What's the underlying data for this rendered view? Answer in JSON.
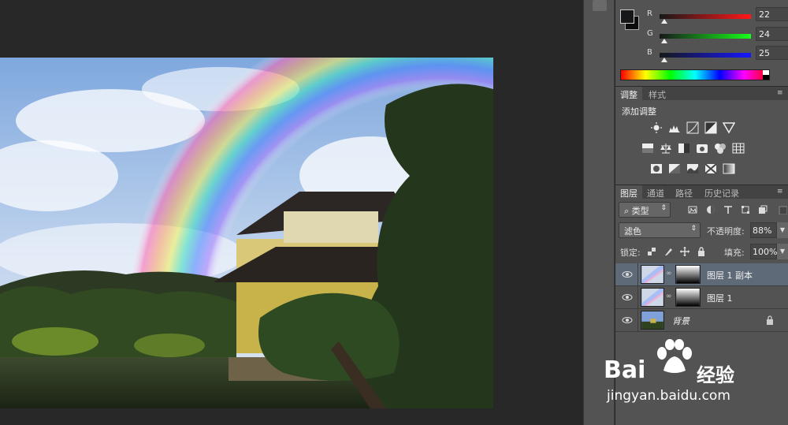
{
  "color_panel": {
    "r_label": "R",
    "r_value": "22",
    "g_label": "G",
    "g_value": "24",
    "b_label": "B",
    "b_value": "25",
    "foreground_color": "#161819"
  },
  "adjust_panel": {
    "tabs": [
      "调整",
      "样式"
    ],
    "title": "添加调整"
  },
  "layers_panel": {
    "tabs": [
      "图层",
      "通道",
      "路径",
      "历史记录"
    ],
    "filter_label": "类型",
    "blend_mode": "滤色",
    "opacity_label": "不透明度:",
    "opacity_value": "88%",
    "lock_label": "锁定:",
    "fill_label": "填充:",
    "fill_value": "100%",
    "layers": [
      {
        "name": "图层 1 副本",
        "selected": true
      },
      {
        "name": "图层 1",
        "selected": false
      },
      {
        "name": "背景",
        "selected": false
      }
    ]
  },
  "watermark": {
    "brand": "Bai",
    "brand2": "经验",
    "url": "jingyan.baidu.com"
  }
}
